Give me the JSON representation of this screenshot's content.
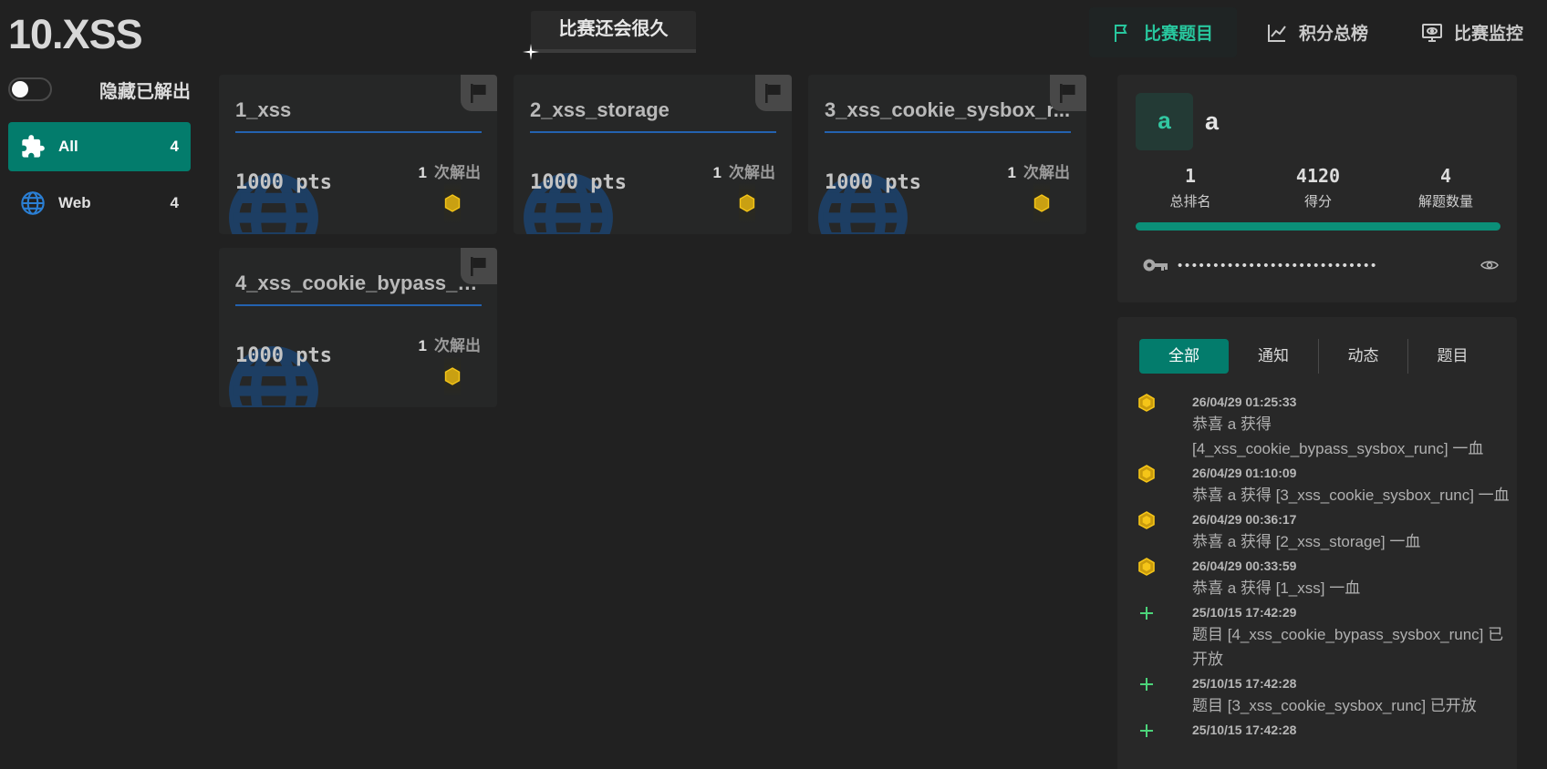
{
  "header": {
    "title": "10.XSS",
    "timer_text": "比赛还会很久"
  },
  "nav": [
    {
      "label": "比赛题目",
      "icon": "flag-icon",
      "active": true
    },
    {
      "label": "积分总榜",
      "icon": "chart-line-icon",
      "active": false
    },
    {
      "label": "比赛监控",
      "icon": "monitor-eye-icon",
      "active": false
    }
  ],
  "sidebar": {
    "hide_solved_label": "隐藏已解出",
    "hide_solved_on": false,
    "categories": [
      {
        "label": "All",
        "count": "4",
        "icon": "puzzle-icon",
        "active": true
      },
      {
        "label": "Web",
        "count": "4",
        "icon": "globe-icon",
        "active": false
      }
    ]
  },
  "challenges": [
    {
      "name": "1_xss",
      "points": "1000 pts",
      "solves": "1",
      "solves_label": "次解出"
    },
    {
      "name": "2_xss_storage",
      "points": "1000 pts",
      "solves": "1",
      "solves_label": "次解出"
    },
    {
      "name": "3_xss_cookie_sysbox_r...",
      "points": "1000 pts",
      "solves": "1",
      "solves_label": "次解出"
    },
    {
      "name": "4_xss_cookie_bypass_s...",
      "points": "1000 pts",
      "solves": "1",
      "solves_label": "次解出"
    }
  ],
  "profile": {
    "avatar_letter": "a",
    "name": "a",
    "rank_value": "1",
    "rank_label": "总排名",
    "score_value": "4120",
    "score_label": "得分",
    "solved_value": "4",
    "solved_label": "解题数量",
    "progress_fraction": 1.0,
    "token_masked": "••••••••••••••••••••••••••••"
  },
  "feed": {
    "tabs": [
      {
        "label": "全部",
        "active": true
      },
      {
        "label": "通知",
        "active": false
      },
      {
        "label": "动态",
        "active": false
      },
      {
        "label": "题目",
        "active": false
      }
    ],
    "events": [
      {
        "type": "blood",
        "time": "26/04/29 01:25:33",
        "lines": [
          "恭喜 a 获得",
          "[4_xss_cookie_bypass_sysbox_runc] 一血"
        ]
      },
      {
        "type": "blood",
        "time": "26/04/29 01:10:09",
        "lines": [
          "恭喜 a 获得 [3_xss_cookie_sysbox_runc] 一血"
        ]
      },
      {
        "type": "blood",
        "time": "26/04/29 00:36:17",
        "lines": [
          "恭喜 a 获得 [2_xss_storage] 一血"
        ]
      },
      {
        "type": "blood",
        "time": "26/04/29 00:33:59",
        "lines": [
          "恭喜 a 获得 [1_xss] 一血"
        ]
      },
      {
        "type": "new",
        "time": "25/10/15 17:42:29",
        "lines": [
          "题目 [4_xss_cookie_bypass_sysbox_runc] 已",
          "开放"
        ]
      },
      {
        "type": "new",
        "time": "25/10/15 17:42:28",
        "lines": [
          "题目 [3_xss_cookie_sysbox_runc] 已开放"
        ]
      },
      {
        "type": "new",
        "time": "25/10/15 17:42:28",
        "lines": []
      }
    ]
  },
  "colors": {
    "accent": "#037c6c",
    "accent_text": "#28c79e",
    "underline": "#2362b0",
    "medal": "#f5c518",
    "new_icon": "#4cd47a"
  }
}
